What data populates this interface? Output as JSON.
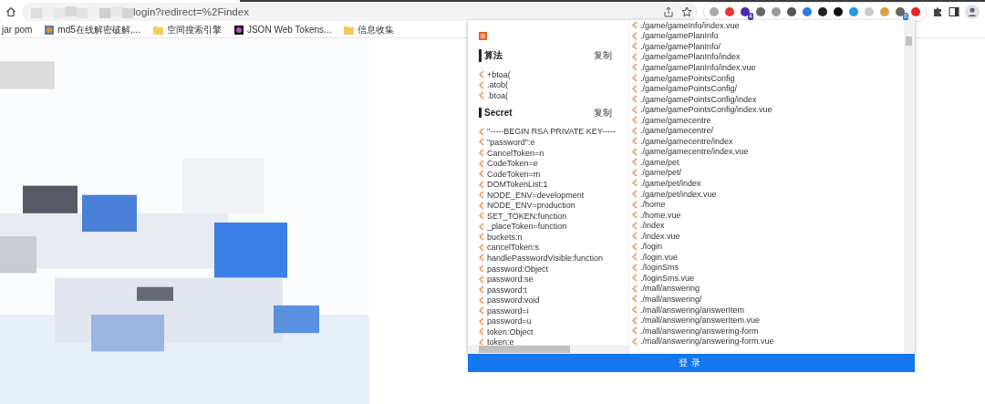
{
  "address_bar": {
    "url": "login?redirect=%2Findex"
  },
  "extension_badges": [
    {
      "text": "4",
      "color": "#5b2bc4"
    },
    {
      "text": "8",
      "color": "#1a73e8"
    }
  ],
  "bookmarks": [
    {
      "label": "jar pom",
      "kind": "plain"
    },
    {
      "label": "md5在线解密破解,...",
      "kind": "site"
    },
    {
      "label": "空间搜索引擎",
      "kind": "folder"
    },
    {
      "label": "JSON Web Tokens...",
      "kind": "site"
    },
    {
      "label": "信息收集",
      "kind": "folder"
    }
  ],
  "popup": {
    "sections": [
      {
        "title": "算法",
        "action": "复制",
        "items": [
          "+btoa(",
          ".atob(",
          ".btoa("
        ]
      },
      {
        "title": "Secret",
        "action": "复制",
        "items": [
          "\"-----BEGIN RSA PRIVATE KEY-----",
          "\"password\":e",
          "CancelToken=n",
          "CodeToken=e",
          "CodeToken=m",
          "DOMTokenList:1",
          "NODE_ENV=development",
          "NODE_ENV=production",
          "SET_TOKEN:function",
          "_placeToken=function",
          "buckets:n",
          "cancelToken:s",
          "handlePasswordVisible:function",
          "password:Object",
          "password:se",
          "password:t",
          "password:void",
          "password=i",
          "password=u",
          "token:Object",
          "token:e"
        ]
      }
    ],
    "paths": [
      "./game/gameInfo/index.vue",
      "./game/gamePlanInfo",
      "./game/gamePlanInfo/",
      "./game/gamePlanInfo/index",
      "./game/gamePlanInfo/index.vue",
      "./game/gamePointsConfig",
      "./game/gamePointsConfig/",
      "./game/gamePointsConfig/index",
      "./game/gamePointsConfig/index.vue",
      "./game/gamecentre",
      "./game/gamecentre/",
      "./game/gamecentre/index",
      "./game/gamecentre/index.vue",
      "./game/pet",
      "./game/pet/",
      "./game/pet/index",
      "./game/pet/index.vue",
      "./home",
      "./home.vue",
      "./index",
      "./index.vue",
      "./login",
      "./login.vue",
      "./loginSms",
      "./loginSms.vue",
      "./mall/answering",
      "./mall/answering/",
      "./mall/answering/answerItem",
      "./mall/answering/answerItem.vue",
      "./mall/answering/answering-form",
      "./mall/answering/answering-form.vue"
    ]
  },
  "login_button": "登录"
}
